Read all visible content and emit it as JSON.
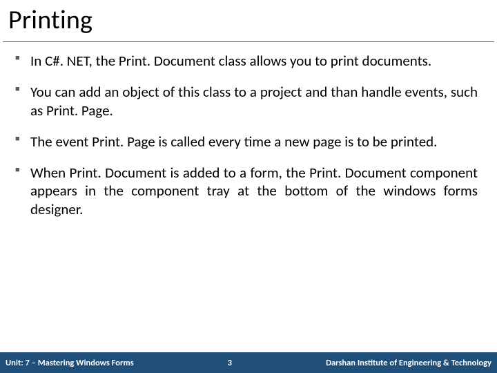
{
  "title": "Printing",
  "bullets": [
    "In C#. NET, the Print. Document class allows you to print documents.",
    "You can add an object of this class to a project and than handle events, such as Print. Page.",
    "The event Print. Page is called every time a new page is to be printed.",
    "When Print. Document is added to a form, the Print. Document component appears in the component tray at the bottom of the windows forms designer."
  ],
  "footer": {
    "unit": "Unit: 7 – Mastering Windows Forms",
    "page": "3",
    "org": "Darshan Institute of Engineering & Technology"
  }
}
